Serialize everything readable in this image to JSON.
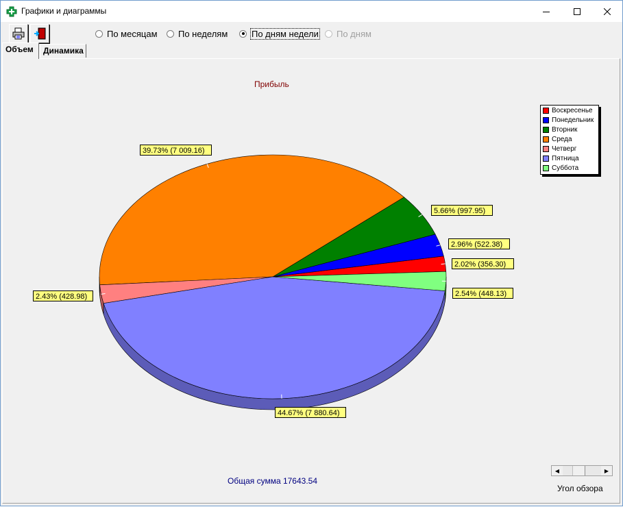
{
  "window": {
    "title": "Графики и диаграммы",
    "controls": {
      "minimize": "minimize-icon",
      "maximize": "maximize-icon",
      "close": "close-icon"
    }
  },
  "toolbar": {
    "buttons": [
      {
        "icon": "printer-icon"
      },
      {
        "icon": "exit-door-icon"
      }
    ]
  },
  "period_options": [
    {
      "label": "По месяцам",
      "checked": false,
      "disabled": false
    },
    {
      "label": "По неделям",
      "checked": false,
      "disabled": false
    },
    {
      "label": "По дням недели",
      "checked": true,
      "disabled": false
    },
    {
      "label": "По дням",
      "checked": false,
      "disabled": true
    }
  ],
  "tabs": [
    {
      "label": "Объем",
      "active": true
    },
    {
      "label": "Динамика",
      "active": false
    }
  ],
  "chart_data": {
    "type": "pie",
    "title": "Прибыль",
    "categories": [
      "Воскресенье",
      "Понедельник",
      "Вторник",
      "Среда",
      "Четверг",
      "Пятница",
      "Суббота"
    ],
    "values": [
      356.3,
      522.38,
      997.95,
      7009.16,
      428.98,
      7880.64,
      448.13
    ],
    "percentages": [
      2.02,
      2.96,
      5.66,
      39.73,
      2.43,
      44.67,
      2.54
    ],
    "data_labels": [
      "2.02%  (356.30)",
      "2.96%  (522.38)",
      "5.66%  (997.95)",
      "39.73%  (7 009.16)",
      "2.43%  (428.98)",
      "44.67%  (7 880.64)",
      "2.54%  (448.13)"
    ],
    "colors": [
      "#ff0000",
      "#0000ff",
      "#008000",
      "#ff8000",
      "#ff8080",
      "#8080ff",
      "#80ff80"
    ],
    "legend_position": "top-right",
    "three_d": true
  },
  "footer": {
    "total_label": "Общая сумма 17643.54",
    "angle_label": "Угол обзора"
  }
}
